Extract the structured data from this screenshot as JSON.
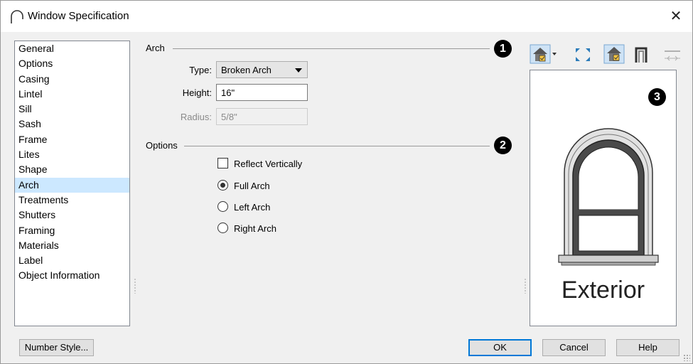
{
  "window": {
    "title": "Window Specification",
    "close_glyph": "✕"
  },
  "sidebar": {
    "items": [
      {
        "label": "General"
      },
      {
        "label": "Options"
      },
      {
        "label": "Casing"
      },
      {
        "label": "Lintel"
      },
      {
        "label": "Sill"
      },
      {
        "label": "Sash"
      },
      {
        "label": "Frame"
      },
      {
        "label": "Lites"
      },
      {
        "label": "Shape"
      },
      {
        "label": "Arch",
        "selected": true
      },
      {
        "label": "Treatments"
      },
      {
        "label": "Shutters"
      },
      {
        "label": "Framing"
      },
      {
        "label": "Materials"
      },
      {
        "label": "Label"
      },
      {
        "label": "Object Information"
      }
    ]
  },
  "arch_group": {
    "label": "Arch",
    "badge": "1",
    "type_label": "Type:",
    "type_value": "Broken Arch",
    "height_label": "Height:",
    "height_value": "16\"",
    "radius_label": "Radius:",
    "radius_value": "5/8\""
  },
  "options_group": {
    "label": "Options",
    "badge": "2",
    "reflect_label": "Reflect Vertically",
    "reflect_checked": false,
    "radios": [
      {
        "label": "Full Arch",
        "checked": true
      },
      {
        "label": "Left Arch",
        "checked": false
      },
      {
        "label": "Right Arch",
        "checked": false
      }
    ]
  },
  "preview": {
    "badge": "3",
    "label": "Exterior",
    "toolbar_icons": [
      "camera-view-dropdown-icon",
      "fill-window-icon",
      "color-view-icon",
      "wall-section-icon",
      "dimension-icon"
    ]
  },
  "footer": {
    "number_style_label": "Number Style...",
    "ok_label": "OK",
    "cancel_label": "Cancel",
    "help_label": "Help"
  }
}
